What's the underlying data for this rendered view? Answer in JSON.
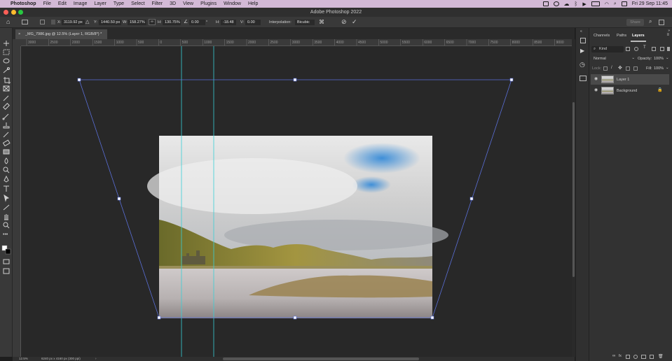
{
  "menubar": {
    "app_name": "Photoshop",
    "items": [
      "File",
      "Edit",
      "Image",
      "Layer",
      "Type",
      "Select",
      "Filter",
      "3D",
      "View",
      "Plugins",
      "Window",
      "Help"
    ],
    "clock": "Fri 29 Sep  11:45"
  },
  "window": {
    "title": "Adobe Photoshop 2022",
    "share_label": "Share"
  },
  "options_bar": {
    "x_label": "X:",
    "x_value": "3119.92 px",
    "y_label": "Y:",
    "y_value": "1440.50 px",
    "w_label": "W:",
    "w_value": "158.27%",
    "h_label": "H:",
    "h_value": "130.75%",
    "angle_value": "0.00",
    "angle_unit": "°",
    "hskew_label": "H:",
    "hskew_value": "-18.48",
    "vskew_label": "V:",
    "vskew_value": "0.00",
    "interpolation_label": "Interpolation:",
    "interpolation_value": "Bicubic"
  },
  "document": {
    "tab_title": "_MG_7986.jpg @ 12.5% (Layer 1, RGB/8*) *",
    "ruler_labels": [
      "3000",
      "2500",
      "2000",
      "1500",
      "1000",
      "500",
      "0",
      "500",
      "1000",
      "1500",
      "2000",
      "2500",
      "3000",
      "3500",
      "4000",
      "4500",
      "5000",
      "5500",
      "6000",
      "6500",
      "7000",
      "7500",
      "8000",
      "8500",
      "9000"
    ]
  },
  "status_bar": {
    "zoom": "12.5%",
    "doc_info": "6240 px x 4160 px (300 ppi)"
  },
  "panels": {
    "tabs": [
      "Channels",
      "Paths",
      "Layers"
    ],
    "active_tab": "Layers",
    "filter_label": "Kind",
    "blend_mode": "Normal",
    "opacity_label": "Opacity:",
    "opacity_value": "100%",
    "lock_label": "Lock:",
    "fill_label": "Fill:",
    "fill_value": "100%",
    "layers": [
      {
        "name": "Layer 1",
        "selected": true
      },
      {
        "name": "Background",
        "selected": false
      }
    ]
  },
  "colors": {
    "menubar_bg": "#d3b9d6",
    "guide": "#38d0d6",
    "transform_box": "#5a6fd8"
  }
}
